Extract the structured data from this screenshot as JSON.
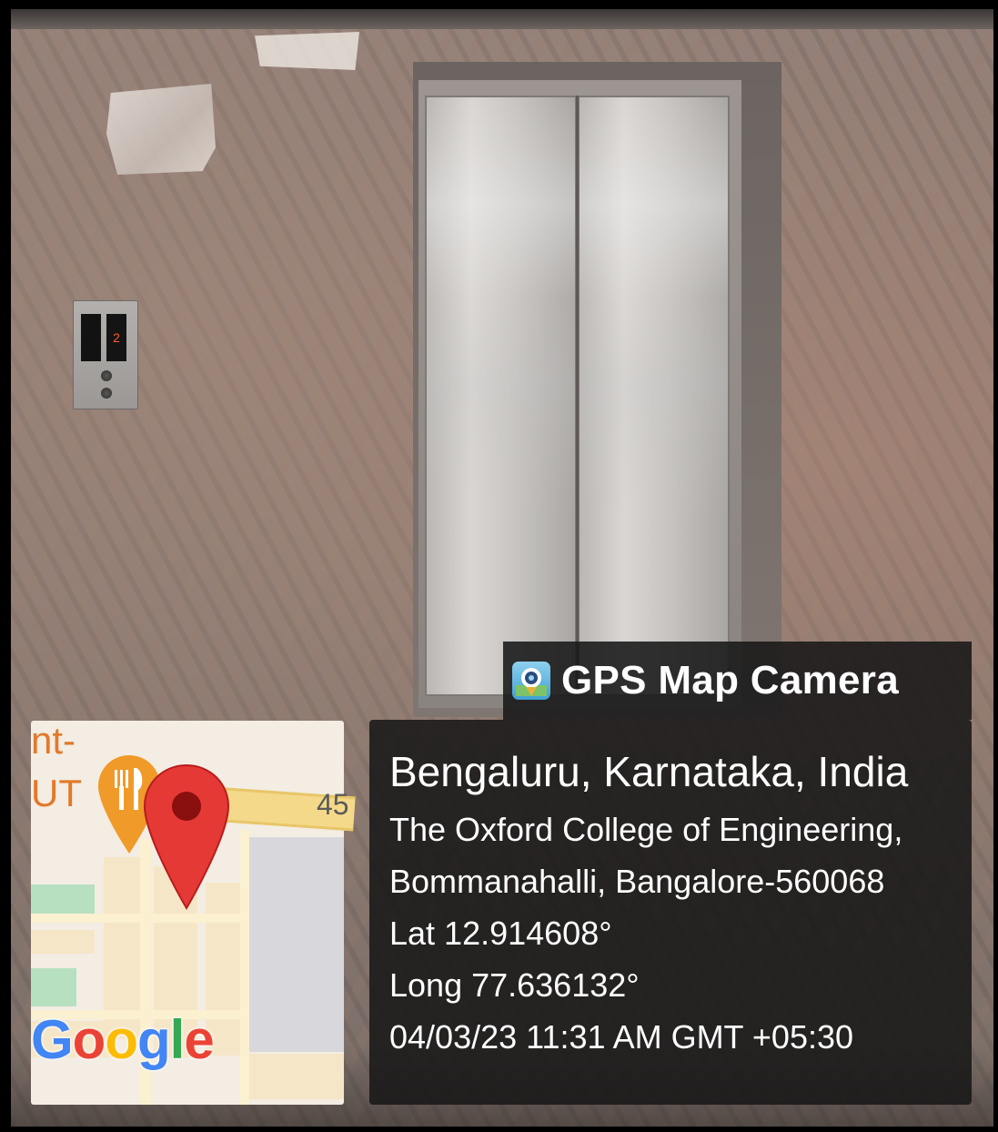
{
  "overlay": {
    "brand": {
      "label": "GPS Map Camera",
      "icon": "gps-map-camera-app-icon"
    },
    "location_title": "Bengaluru, Karnataka, India",
    "address_line_1": "The Oxford College of Engineering,",
    "address_line_2": "Bommanahalli, Bangalore-560068",
    "latitude": "Lat 12.914608°",
    "longitude": "Long 77.636132°",
    "timestamp": "04/03/23 11:31 AM GMT +05:30"
  },
  "map": {
    "label_top": "nt-",
    "label_mid": "UT",
    "label_right": "45",
    "attribution_letters": [
      "G",
      "o",
      "o",
      "g",
      "l",
      "e"
    ],
    "icons": [
      "location-pin-icon",
      "restaurant-icon"
    ]
  },
  "photo": {
    "elevator_floor_display": "2"
  },
  "colors": {
    "overlay_bg": "#181818",
    "pin_red": "#e53935",
    "restaurant_orange": "#f09a2a",
    "google_blue": "#4285F4",
    "google_red": "#EA4335",
    "google_yellow": "#FBBC05",
    "google_green": "#34A853"
  }
}
